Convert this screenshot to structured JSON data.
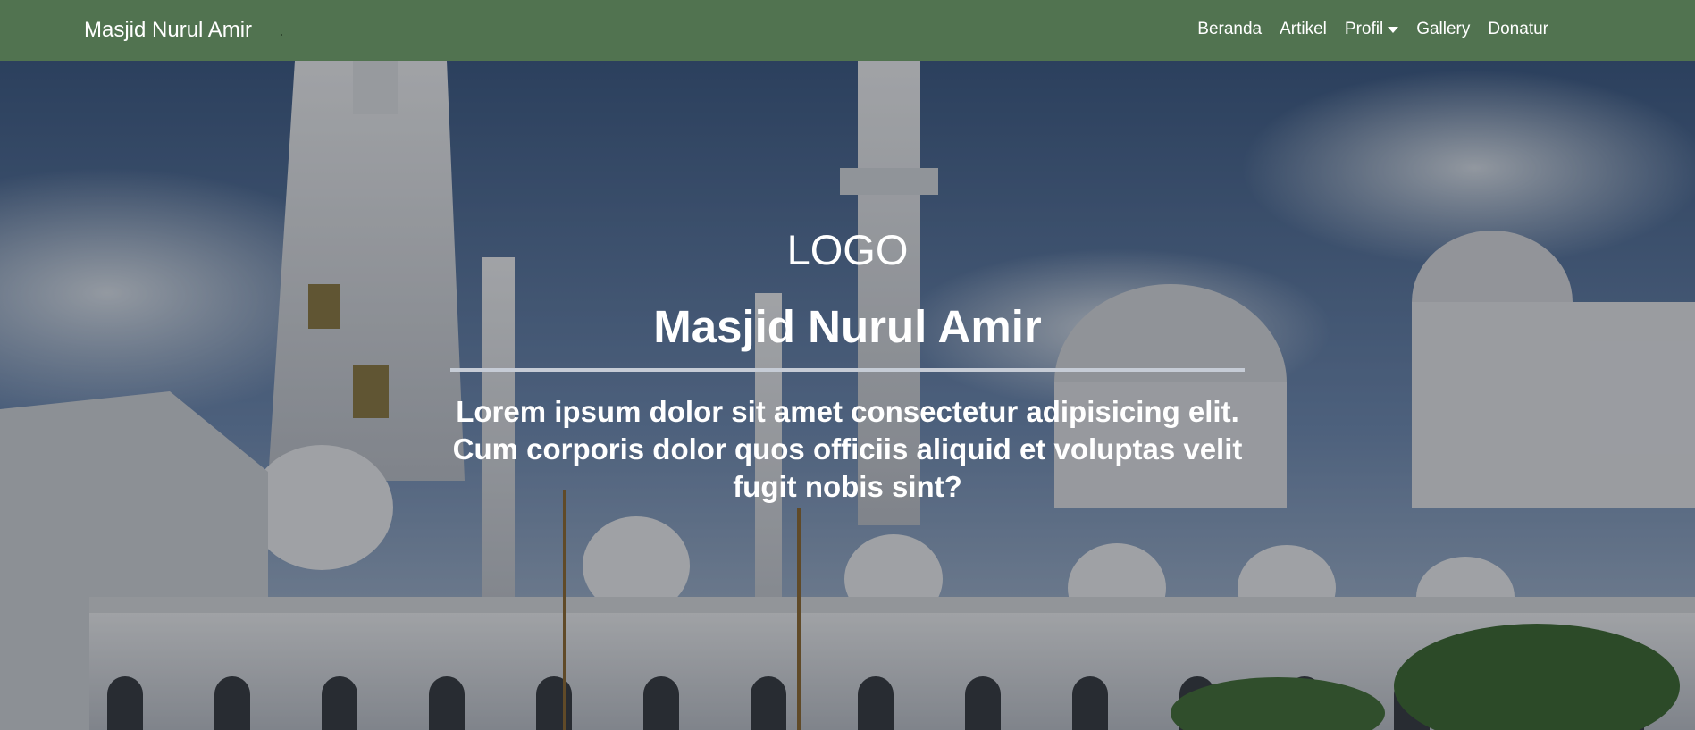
{
  "navbar": {
    "brand": "Masjid Nurul Amir",
    "items": [
      {
        "label": "Beranda"
      },
      {
        "label": "Artikel"
      },
      {
        "label": "Profil",
        "dropdown": true
      },
      {
        "label": "Gallery"
      },
      {
        "label": "Donatur"
      }
    ]
  },
  "hero": {
    "logo": "LOGO",
    "title": "Masjid Nurul Amir",
    "description": "Lorem ipsum dolor sit amet consectetur adipisicing elit. Cum corporis dolor quos officiis aliquid et voluptas velit fugit nobis sint?"
  },
  "colors": {
    "navbar_bg": "#517350",
    "text": "#ffffff",
    "divider": "#c6ccd6"
  }
}
